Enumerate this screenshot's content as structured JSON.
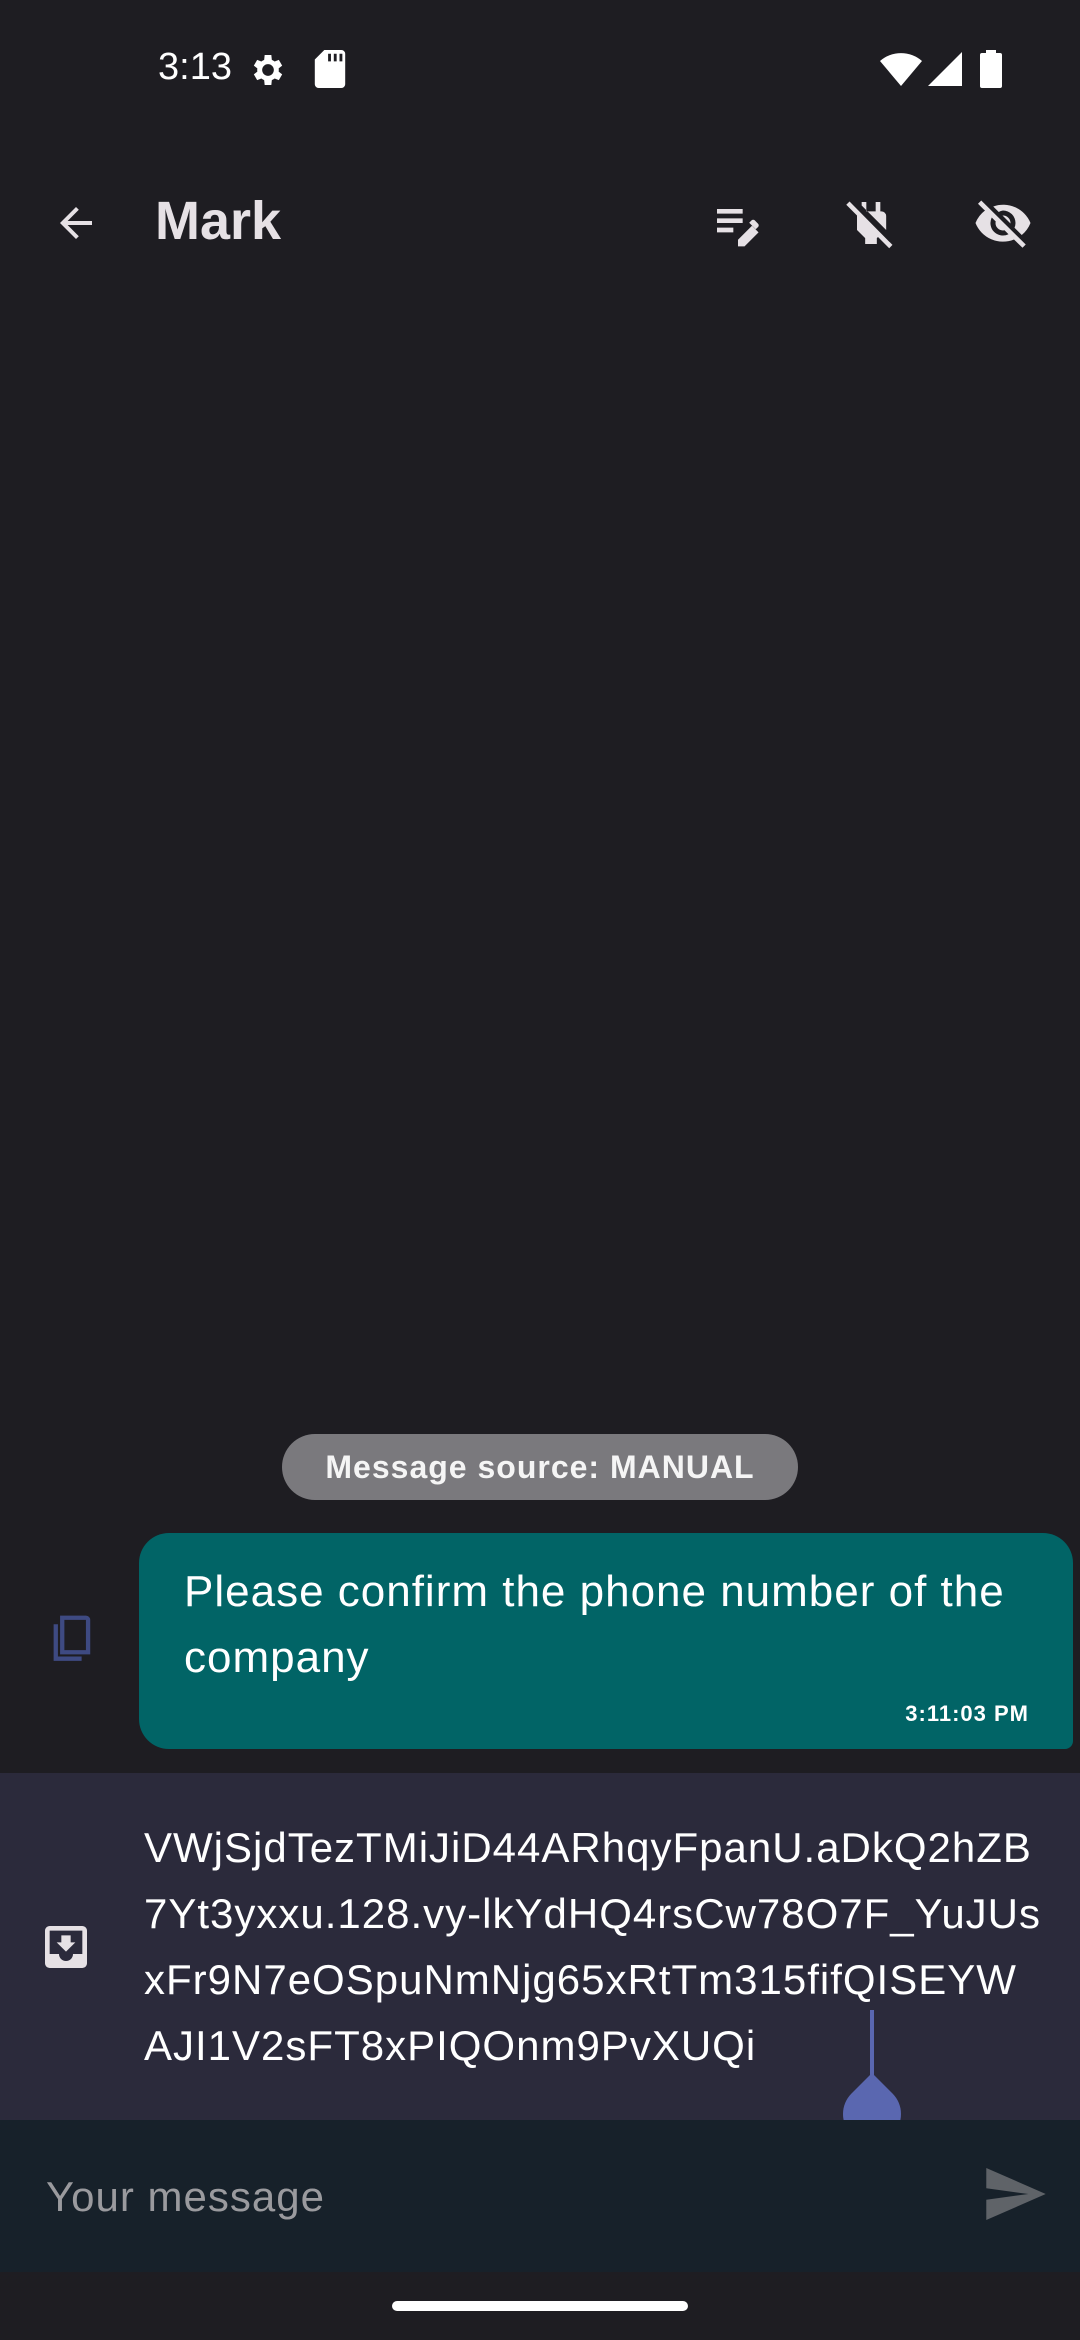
{
  "status_bar": {
    "time": "3:13",
    "left_icons": [
      "settings-gear-icon",
      "sd-card-icon"
    ],
    "right_icons": [
      "wifi-icon",
      "cellular-signal-icon",
      "battery-icon"
    ]
  },
  "app_bar": {
    "title": "Mark",
    "back_icon": "arrow-back-icon",
    "actions": [
      "edit-note-icon",
      "no-power-icon",
      "visibility-off-icon"
    ]
  },
  "conversation": {
    "source_chip": "Message source: MANUAL",
    "message": {
      "text": "Please confirm the phone number of the company",
      "time": "3:11:03 PM",
      "copy_icon": "copy-icon"
    }
  },
  "draft": {
    "icon": "download-icon",
    "text": "VWjSjdTezTMiJiD44ARhqyFpanU.aDkQ2hZB7Yt3yxxu.128.vy-lkYdHQ4rsCw78O7F_YuJUsxFr9N7eOSpuNmNjg65xRtTm315fifQISEYWAJI1V2sFT8xPIQOnm9PvXUQi"
  },
  "composer": {
    "placeholder": "Your message",
    "send_icon": "send-icon"
  },
  "colors": {
    "background": "#1e1d22",
    "bubble": "#016466",
    "draft_panel": "#2b2a3b",
    "composer": "#17212a",
    "chip": "#7a797d",
    "cursor": "#5a67b0"
  }
}
